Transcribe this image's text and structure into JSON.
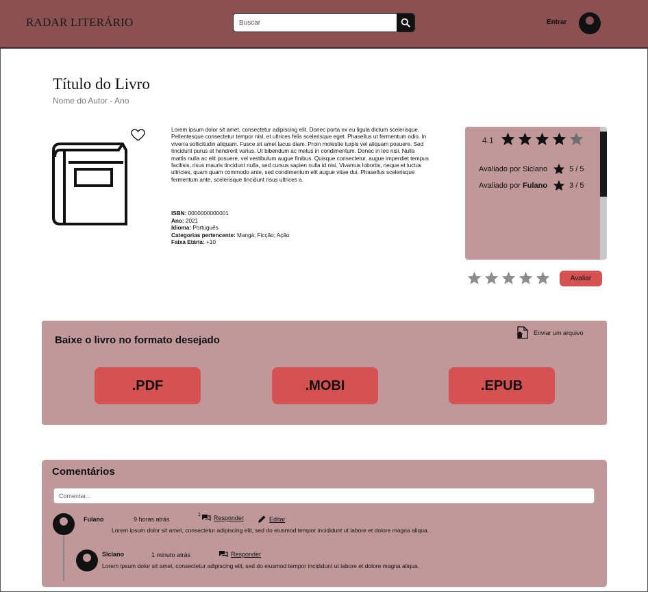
{
  "header": {
    "logo": "RADAR LITERÁRIO",
    "search_placeholder": "Buscar",
    "login_label": "Entrar"
  },
  "book": {
    "title": "Título do Livro",
    "author_year": "Nome do Autor - Ano",
    "description": "Lorem ipsum dolor sit amet, consectetur adipiscing elit. Donec porta ex eu ligula dictum scelerisque. Pellentesque consectetur tempor nisl, et ultrices felis scelerisque eget. Phasellus ut fermentum odio. In viverra sollicitudin aliquam. Fusce sit amet lacus diam. Proin molestie turpis vel aliquam posuere. Sed tincidunt purus at hendrerit varius. Ut bibendum ac metus in condimentum. Donec in leo nisi. Nulla mattis nulla ac elit posuere, vel vestibulum augue finibus. Quisque consectetur, augue imperdiet tempus facilisis, risus mauris tincidunt nulla, sed cursus sapien nulla id nisi. Vivamus lobortis, neque et luctus ultricies, quam quam commodo ante, sed condimentum elit augue vitae dui. Phasellus scelerisque fermentum ante, scelerisque tincidunt risus ultrices a.",
    "meta": {
      "isbn_label": "ISBN:",
      "isbn": "0000000000001",
      "year_label": "Ano:",
      "year": "2021",
      "language_label": "Idioma:",
      "language": "Português",
      "categories_label": "Categorias pertencente:",
      "categories": "Mangá; Ficção; Ação",
      "age_label": "Faixa Etária:",
      "age": "+10"
    }
  },
  "rating": {
    "average": "4.1",
    "average_stars_filled": 4,
    "stars_total": 5,
    "reviews": [
      {
        "prefix": "Avaliado por ",
        "user": "Siclano",
        "bold": false,
        "score": "5 / 5"
      },
      {
        "prefix": "Avaliado por ",
        "user": "Fulano",
        "bold": true,
        "score": "3 / 5"
      }
    ],
    "rate_button": "Avaliar"
  },
  "download": {
    "title": "Baixe o livro no formato desejado",
    "upload_label": "Enviar um arquivo",
    "formats": [
      ".PDF",
      ".MOBI",
      ".EPUB"
    ]
  },
  "comments": {
    "title": "Comentários",
    "input_placeholder": "Comentar...",
    "items": [
      {
        "user": "Fulano",
        "time": "9 horas atrás",
        "reply_count": "1",
        "reply_label": "Responder",
        "edit_label": "Editar",
        "text": "Lorem ipsum dolor sit amet, consectetur adipiscing elit, sed do eiusmod tempor incididunt ut labore et dolore magna aliqua."
      },
      {
        "user": "Siclano",
        "time": "1 minuto atrás",
        "reply_label": "Responder",
        "text": "Lorem ipsum dolor sit amet, consectetur adipiscing elit, sed do eiusmod tempor incididunt ut labore et dolore magna aliqua."
      }
    ]
  },
  "colors": {
    "header_bg": "#8b5052",
    "panel_bg": "#c09899",
    "accent_button": "#d65252"
  },
  "icons": [
    "search-icon",
    "user-avatar-icon",
    "heart-icon",
    "book-icon",
    "star-icon",
    "upload-file-icon",
    "reply-icon",
    "edit-pencil-icon"
  ]
}
